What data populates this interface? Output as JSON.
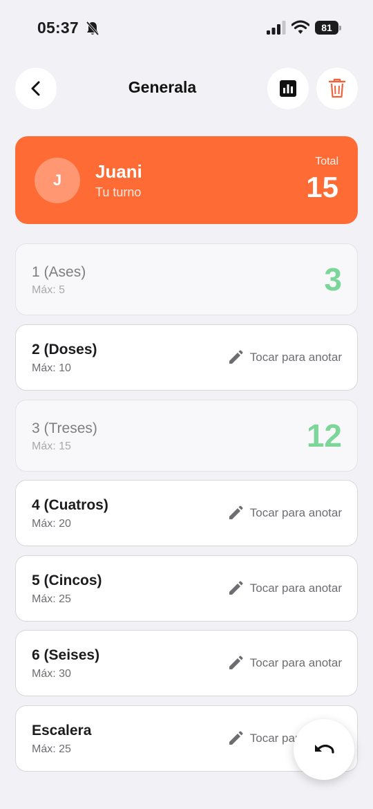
{
  "status_bar": {
    "time": "05:37",
    "battery": "81",
    "icons": [
      "bell-slash-icon",
      "cellular-signal-icon",
      "wifi-icon",
      "battery-icon"
    ]
  },
  "header": {
    "title": "Generala",
    "back_icon": "chevron-left-icon",
    "stats_icon": "bar-chart-icon",
    "delete_icon": "trash-icon"
  },
  "player": {
    "initial": "J",
    "name": "Juani",
    "subtitle": "Tu turno",
    "total_label": "Total",
    "total": "15"
  },
  "categories": [
    {
      "name": "1 (Ases)",
      "max": "Máx: 5",
      "score": "3",
      "hint": ""
    },
    {
      "name": "2 (Doses)",
      "max": "Máx: 10",
      "score": "",
      "hint": "Tocar para anotar"
    },
    {
      "name": "3 (Treses)",
      "max": "Máx: 15",
      "score": "12",
      "hint": ""
    },
    {
      "name": "4 (Cuatros)",
      "max": "Máx: 20",
      "score": "",
      "hint": "Tocar para anotar"
    },
    {
      "name": "5 (Cincos)",
      "max": "Máx: 25",
      "score": "",
      "hint": "Tocar para anotar"
    },
    {
      "name": "6 (Seises)",
      "max": "Máx: 30",
      "score": "",
      "hint": "Tocar para anotar"
    },
    {
      "name": "Escalera",
      "max": "Máx: 25",
      "score": "",
      "hint": "Tocar para anotar"
    }
  ],
  "fab_icon": "undo-icon",
  "colors": {
    "accent": "#ff6b35",
    "score_green": "#7cd69a",
    "delete_red": "#f0623a",
    "background": "#f2f2f6"
  }
}
